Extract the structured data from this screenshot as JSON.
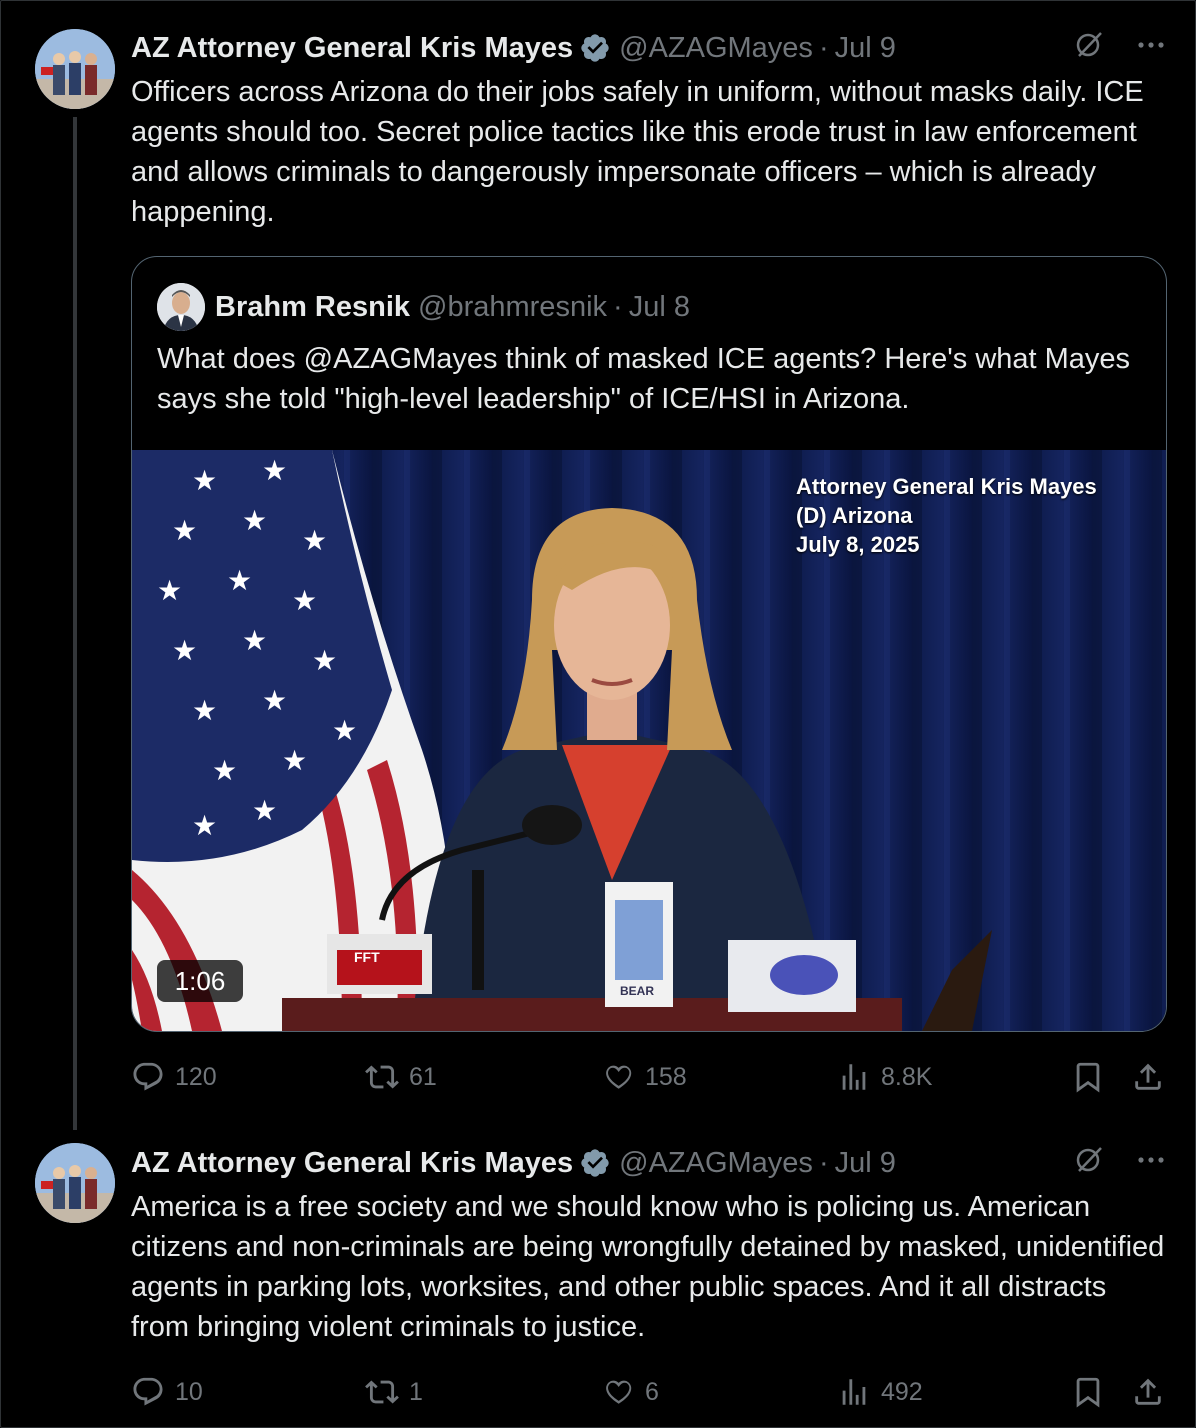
{
  "tweets": [
    {
      "author_name": "AZ Attorney General Kris Mayes",
      "handle": "@AZAGMayes",
      "separator": "·",
      "date": "Jul 9",
      "text": "Officers across Arizona do their jobs safely in uniform, without masks daily. ICE agents should too. Secret police tactics like this erode trust in law enforcement and allows criminals to dangerously impersonate officers – which is already happening.",
      "quote": {
        "author_name": "Brahm Resnik",
        "handle": "@brahmresnik",
        "separator": "·",
        "date": "Jul 8",
        "text": "What does @AZAGMayes think of masked ICE agents? Here's what Mayes says she told \"high-level leadership\" of ICE/HSI in Arizona.",
        "video": {
          "overlay_line1": "Attorney General Kris Mayes",
          "overlay_line2": "(D) Arizona",
          "overlay_line3": "July 8, 2025",
          "duration": "1:06",
          "prop_label_1": "FFT",
          "prop_label_2": "BEAR"
        }
      },
      "stats": {
        "replies": "120",
        "reposts": "61",
        "likes": "158",
        "views": "8.8K"
      }
    },
    {
      "author_name": "AZ Attorney General Kris Mayes",
      "handle": "@AZAGMayes",
      "separator": "·",
      "date": "Jul 9",
      "text": "America is a free society and we should know who is policing us. American citizens and non-criminals are being wrongfully detained by masked, unidentified agents in parking lots, worksites, and other public spaces. And it all distracts from bringing violent criminals to justice.",
      "stats": {
        "replies": "10",
        "reposts": "1",
        "likes": "6",
        "views": "492"
      }
    }
  ],
  "colors": {
    "background": "#000000",
    "text": "#e7e9ea",
    "muted": "#71767b",
    "verified": "#829aab",
    "border": "#536471"
  },
  "icons": [
    "verified-badge-icon",
    "grok-icon",
    "more-icon",
    "reply-icon",
    "repost-icon",
    "like-icon",
    "views-icon",
    "bookmark-icon",
    "share-icon"
  ]
}
